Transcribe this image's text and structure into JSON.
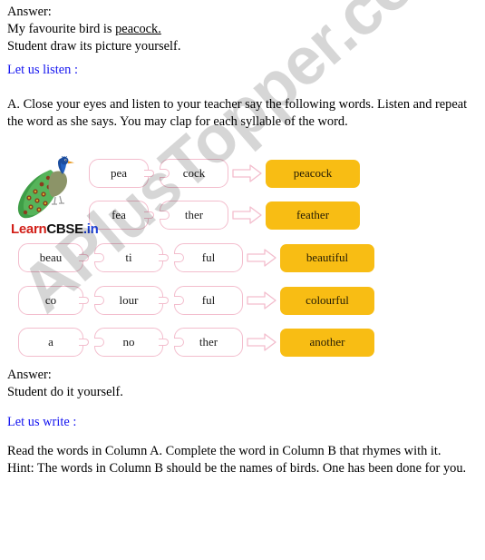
{
  "answer_1": {
    "label": "Answer:",
    "line_1_prefix": "My favourite bird is ",
    "line_1_underlined": "peacock.",
    "line_2": "Student draw its picture yourself."
  },
  "headings": {
    "listen": "Let us listen :",
    "write": "Let us write :"
  },
  "instruction_a": "A. Close your eyes and listen to your teacher say the following words. Listen and repeat the word as she says. You may clap for each syllable of the word.",
  "answer_2": {
    "label": "Answer:",
    "line_1": "Student do it yourself."
  },
  "instruction_b": {
    "line_1": "Read the words in Column A. Complete the word in Column B that rhymes with it.",
    "line_2": "Hint: The words in Column B should be the names of birds. One has been done for you."
  },
  "diagram": {
    "rows": [
      {
        "syllables": [
          "pea",
          "cock"
        ],
        "word": "peacock"
      },
      {
        "syllables": [
          "fea",
          "ther"
        ],
        "word": "feather"
      },
      {
        "syllables": [
          "beau",
          "ti",
          "ful"
        ],
        "word": "beautiful"
      },
      {
        "syllables": [
          "co",
          "lour",
          "ful"
        ],
        "word": "colourful"
      },
      {
        "syllables": [
          "a",
          "no",
          "ther"
        ],
        "word": "another"
      }
    ]
  },
  "branding": {
    "learncbse_part1": "Learn",
    "learncbse_part2": "CBSE",
    "learncbse_part3": ".in"
  },
  "watermark": {
    "text": "APlusTopper.com"
  },
  "colors": {
    "heading_blue": "#1414f0",
    "result_orange": "#f8bd14",
    "box_border_pink": "#f3bdcd",
    "logo_red": "#d21f18"
  }
}
